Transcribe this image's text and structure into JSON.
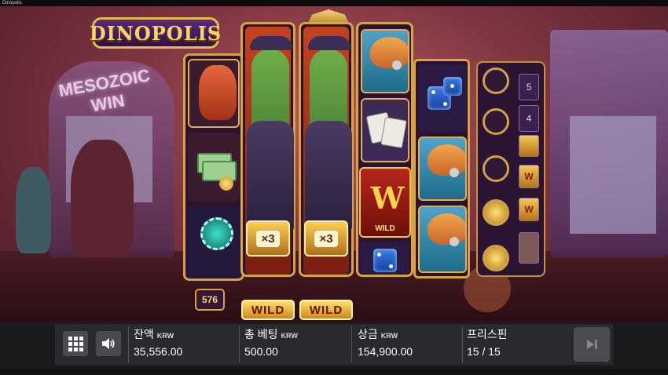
{
  "window": {
    "title": "Dinopolis"
  },
  "logo": {
    "text": "DINOPOLIS"
  },
  "background": {
    "sign_text": "MESOZOIC WIN"
  },
  "reels": {
    "ways": "576",
    "multiplier_1": "×3",
    "multiplier_2": "×3",
    "wild_1": "WILD",
    "wild_2": "WILD",
    "wild_tile_label": "WILD",
    "wild_tile_letter": "W"
  },
  "meter": {
    "counts": [
      "5",
      "4"
    ],
    "wild_letter": "W"
  },
  "bottom_bar": {
    "balance": {
      "label": "잔액",
      "currency": "KRW",
      "value": "35,556.00"
    },
    "bet": {
      "label": "총 베팅",
      "currency": "KRW",
      "value": "500.00"
    },
    "win": {
      "label": "상금",
      "currency": "KRW",
      "value": "154,900.00"
    },
    "freespins": {
      "label": "프리스핀",
      "value": "15 / 15"
    }
  },
  "icons": {
    "menu": "grid-icon",
    "sound": "speaker-icon",
    "skip": "skip-forward-icon"
  },
  "colors": {
    "frame_gold": "#d8a23f",
    "bar_bg": "#1b1b1e",
    "text_white": "#ffffff"
  }
}
